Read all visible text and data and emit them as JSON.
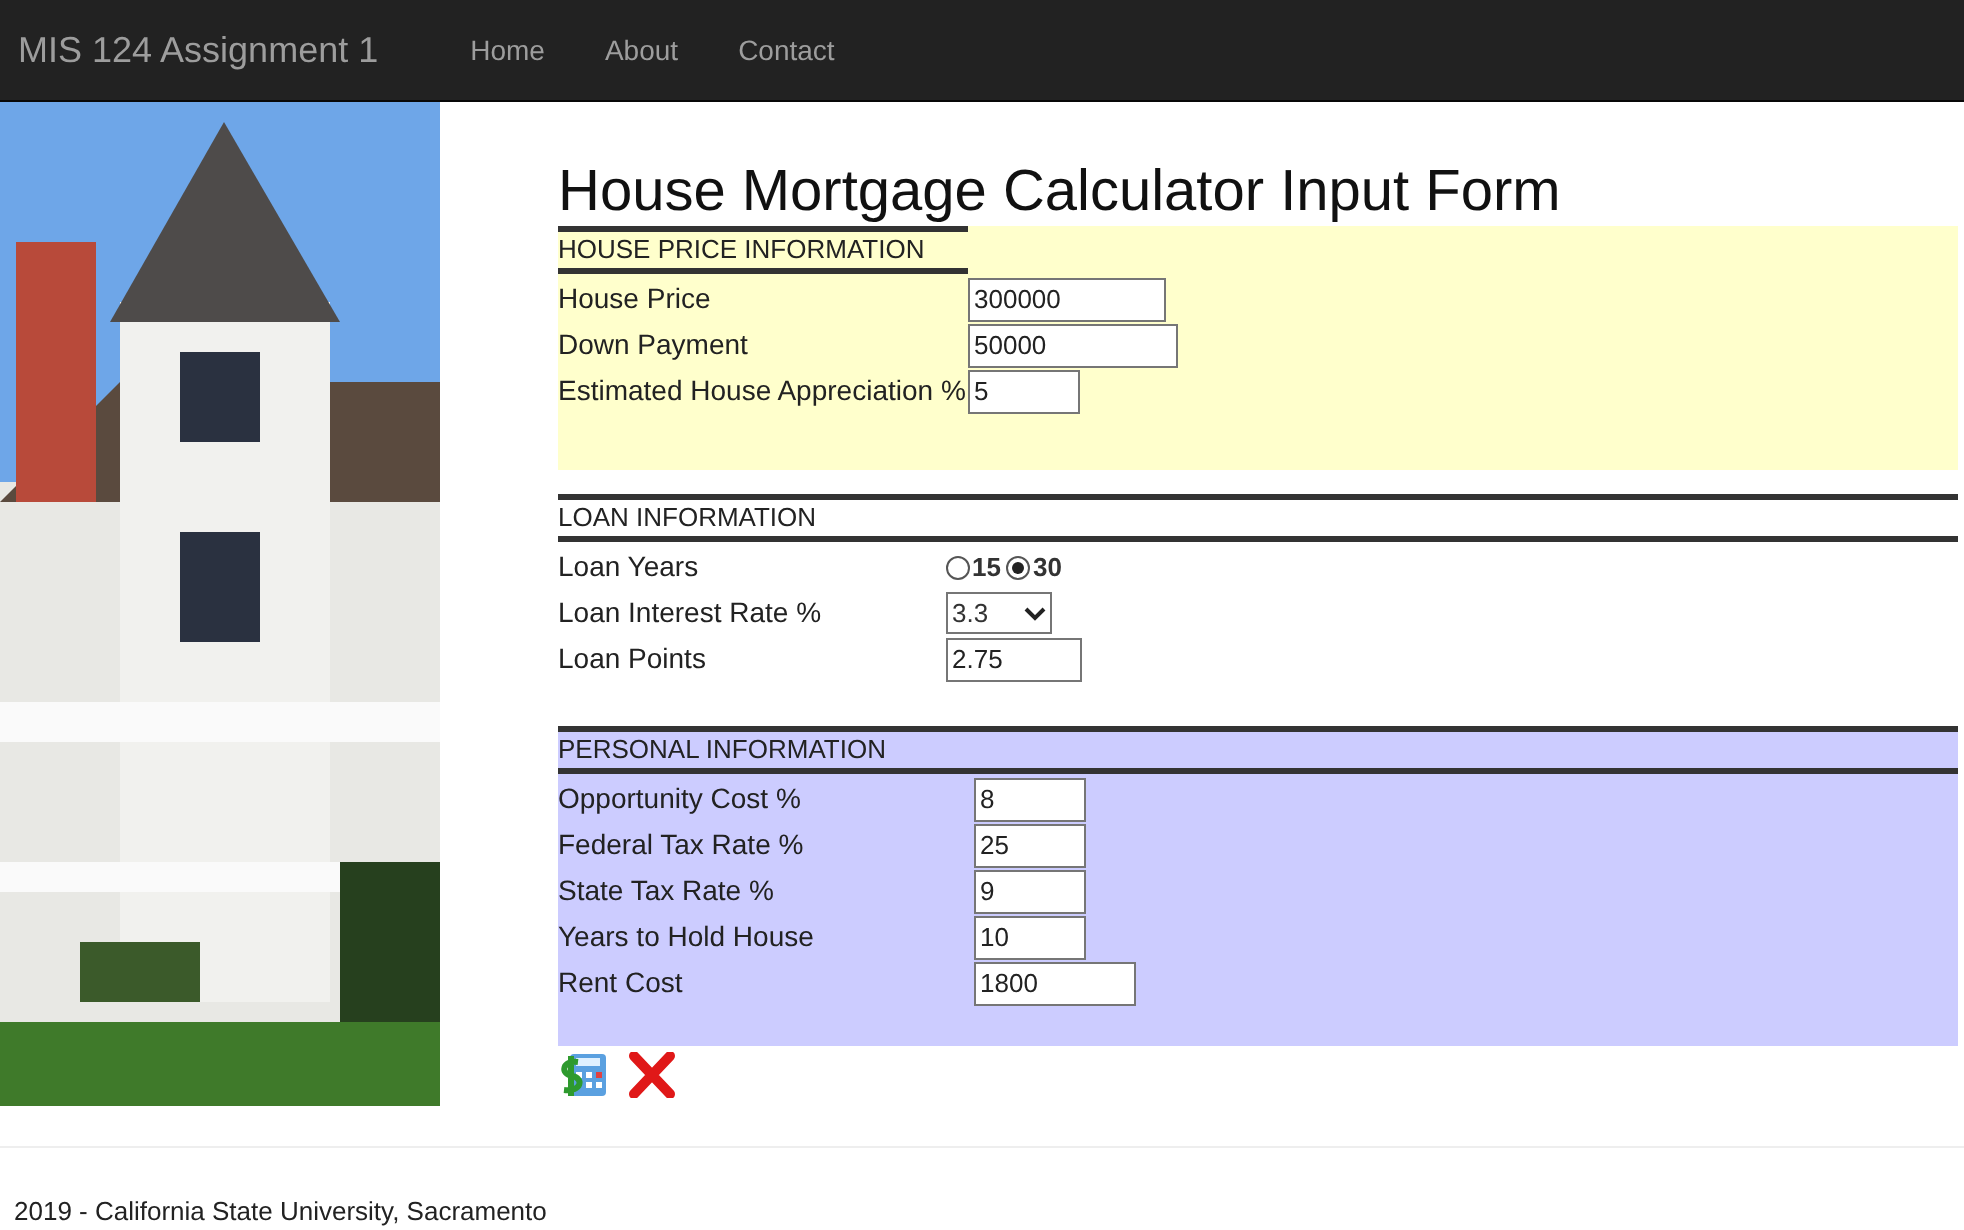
{
  "navbar": {
    "brand": "MIS 124 Assignment 1",
    "links": [
      {
        "label": "Home"
      },
      {
        "label": "About"
      },
      {
        "label": "Contact"
      }
    ]
  },
  "title": "House Mortgage Calculator Input Form",
  "sections": [
    {
      "heading": "HOUSE PRICE INFORMATION",
      "color": "#ffffcc",
      "fields": [
        {
          "kind": "text",
          "label": "House Price",
          "value": "300000"
        },
        {
          "kind": "text",
          "label": "Down Payment",
          "value": "50000"
        },
        {
          "kind": "text",
          "label": "Estimated House Appreciation %",
          "value": "5"
        }
      ]
    },
    {
      "heading": "LOAN INFORMATION",
      "color": "#ffffff",
      "fields": [
        {
          "kind": "radio",
          "label": "Loan Years",
          "options": [
            {
              "label": "15",
              "selected": false
            },
            {
              "label": "30",
              "selected": true
            }
          ]
        },
        {
          "kind": "select",
          "label": "Loan Interest Rate %",
          "value": "3.3"
        },
        {
          "kind": "text",
          "label": "Loan Points",
          "value": "2.75"
        }
      ]
    },
    {
      "heading": "PERSONAL INFORMATION",
      "color": "#ccccff",
      "fields": [
        {
          "kind": "text",
          "label": "Opportunity Cost %",
          "value": "8"
        },
        {
          "kind": "text",
          "label": "Federal Tax Rate %",
          "value": "25"
        },
        {
          "kind": "text",
          "label": "State Tax Rate %",
          "value": "9"
        },
        {
          "kind": "text",
          "label": "Years to Hold House",
          "value": "10"
        },
        {
          "kind": "text",
          "label": "Rent Cost",
          "value": "1800"
        }
      ]
    }
  ],
  "footer": "2019 - California State University, Sacramento"
}
